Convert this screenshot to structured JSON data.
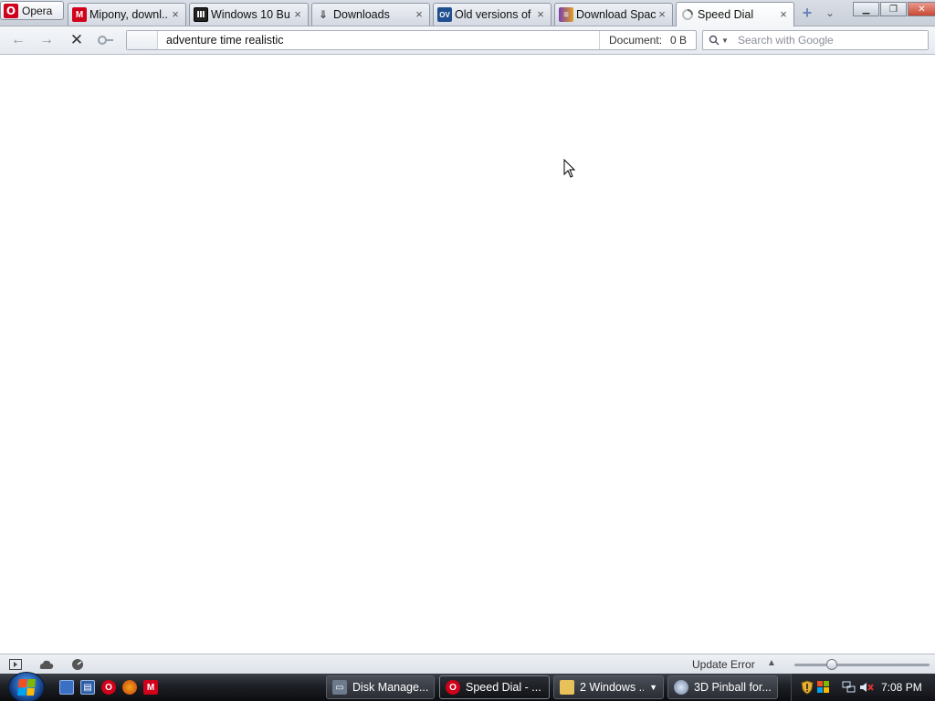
{
  "browser": {
    "menu_label": "Opera",
    "tabs": [
      {
        "title": "Mipony, downl...",
        "icon": "mipony-icon",
        "color": "#d0021b",
        "active": false
      },
      {
        "title": "Windows 10 Bu...",
        "icon": "archive-icon",
        "color": "#333333",
        "active": false
      },
      {
        "title": "Downloads",
        "icon": "downloads-icon",
        "color": "#555555",
        "active": false
      },
      {
        "title": "Old versions of ...",
        "icon": "oldversion-icon",
        "color": "#1f4f8f",
        "active": false
      },
      {
        "title": "Download Spac...",
        "icon": "downloadspace-icon",
        "color": "#7a3fb0",
        "active": false
      },
      {
        "title": "Speed Dial",
        "icon": "loading-icon",
        "color": "#888888",
        "active": true
      }
    ],
    "address": {
      "value": "adventure time realistic",
      "document_label": "Document:",
      "document_size": "0 B"
    },
    "search": {
      "placeholder": "Search with Google",
      "engine_icon": "search-icon"
    },
    "status": {
      "update_text": "Update Error",
      "zoom_fraction": 0.28
    }
  },
  "taskbar": {
    "tasks": [
      {
        "title": "Disk Manage...",
        "icon": "disk-management-icon",
        "color": "#6c7a8c",
        "active": false
      },
      {
        "title": "Speed Dial - ...",
        "icon": "opera-icon",
        "color": "#d0021b",
        "active": true
      },
      {
        "title": "2 Windows ...",
        "icon": "folder-icon",
        "color": "#e8c15a",
        "active": false
      },
      {
        "title": "3D Pinball for...",
        "icon": "pinball-icon",
        "color": "#8aa0c0",
        "active": false
      }
    ],
    "clock": "7:08 PM"
  },
  "colors": {
    "accent": "#1b4f9b",
    "opera_red": "#d0021b"
  }
}
